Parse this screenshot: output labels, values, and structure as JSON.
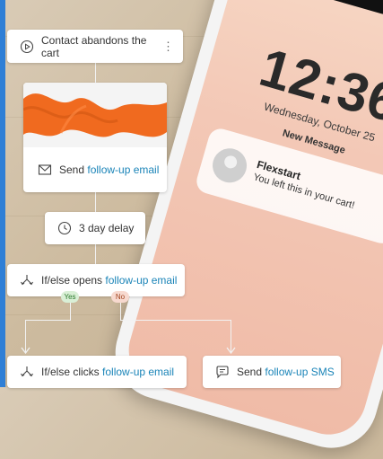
{
  "lockscreen": {
    "time": "12:36",
    "date": "Wednesday, October 25",
    "section_title": "New Message",
    "notification": {
      "sender": "Flexstart",
      "message": "You left this in your cart!"
    }
  },
  "workflow": {
    "trigger": {
      "label": "Contact abandons the cart",
      "icon": "play-circle-icon",
      "menu_icon": "kebab-menu-icon"
    },
    "send_email": {
      "prefix": "Send ",
      "link": "follow-up email",
      "icon": "envelope-icon"
    },
    "delay": {
      "label": "3 day delay",
      "icon": "clock-icon"
    },
    "ifelse_opens": {
      "prefix": "If/else opens ",
      "link": "follow-up email",
      "icon": "branch-icon"
    },
    "branches": {
      "yes": "Yes",
      "no": "No"
    },
    "ifelse_clicks": {
      "prefix": "If/else clicks ",
      "link": "follow-up email",
      "icon": "branch-icon"
    },
    "send_sms": {
      "prefix": "Send ",
      "link": "follow-up SMS",
      "icon": "chat-icon"
    }
  },
  "colors": {
    "accent": "#2f7fd6",
    "link": "#1a84b8",
    "fabric": "#f06a1f"
  }
}
